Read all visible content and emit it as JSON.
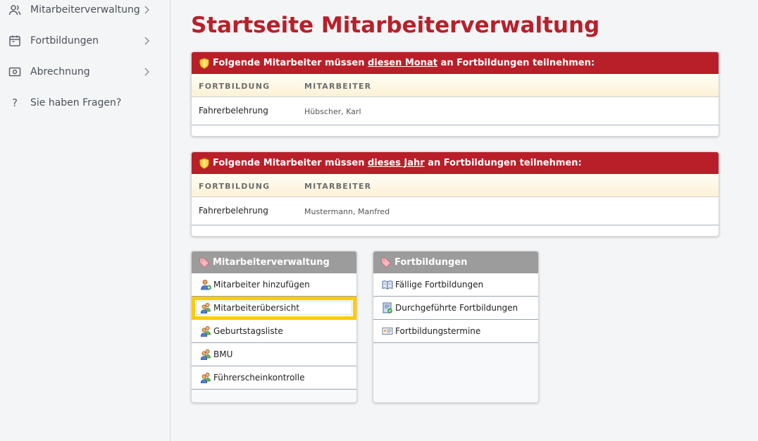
{
  "sidebar": {
    "items": [
      {
        "label": "Mitarbeiterverwaltung",
        "icon": "users-icon",
        "has_chevron": true
      },
      {
        "label": "Fortbildungen",
        "icon": "calendar-icon",
        "has_chevron": true
      },
      {
        "label": "Abrechnung",
        "icon": "money-icon",
        "has_chevron": true
      },
      {
        "label": "Sie haben Fragen?",
        "icon": "question-icon",
        "has_chevron": false
      }
    ]
  },
  "main": {
    "title": "Startseite Mitarbeiterverwaltung",
    "panel_month": {
      "title_pre": "Folgende Mitarbeiter müssen ",
      "title_em": "diesen Monat",
      "title_post": " an Fortbildungen teilnehmen:",
      "col_training": "FORTBILDUNG",
      "col_employee": "MITARBEITER",
      "rows": [
        {
          "training": "Fahrerbelehrung",
          "employee": "Hübscher, Karl"
        }
      ]
    },
    "panel_year": {
      "title_pre": "Folgende Mitarbeiter müssen ",
      "title_em": "dieses Jahr",
      "title_post": " an Fortbildungen teilnehmen:",
      "col_training": "FORTBILDUNG",
      "col_employee": "MITARBEITER",
      "rows": [
        {
          "training": "Fahrerbelehrung",
          "employee": "Mustermann, Manfred"
        }
      ]
    },
    "box_employees": {
      "title": "Mitarbeiterverwaltung",
      "items": [
        {
          "label": "Mitarbeiter hinzufügen",
          "icon": "user-add-icon"
        },
        {
          "label": "Mitarbeiterübersicht",
          "icon": "users-group-icon",
          "highlighted": true
        },
        {
          "label": "Geburtstagsliste",
          "icon": "users-group-icon"
        },
        {
          "label": "BMU",
          "icon": "users-group-icon"
        },
        {
          "label": "Führerscheinkontrolle",
          "icon": "users-group-icon"
        }
      ]
    },
    "box_trainings": {
      "title": "Fortbildungen",
      "items": [
        {
          "label": "Fällige Fortbildungen",
          "icon": "book-icon"
        },
        {
          "label": "Durchgeführte Fortbildungen",
          "icon": "document-check-icon"
        },
        {
          "label": "Fortbildungstermine",
          "icon": "id-card-icon"
        }
      ]
    }
  },
  "colors": {
    "accent_red": "#b81f29",
    "box_header_gray": "#9c9c9c",
    "highlight_yellow": "#ffcc00"
  }
}
